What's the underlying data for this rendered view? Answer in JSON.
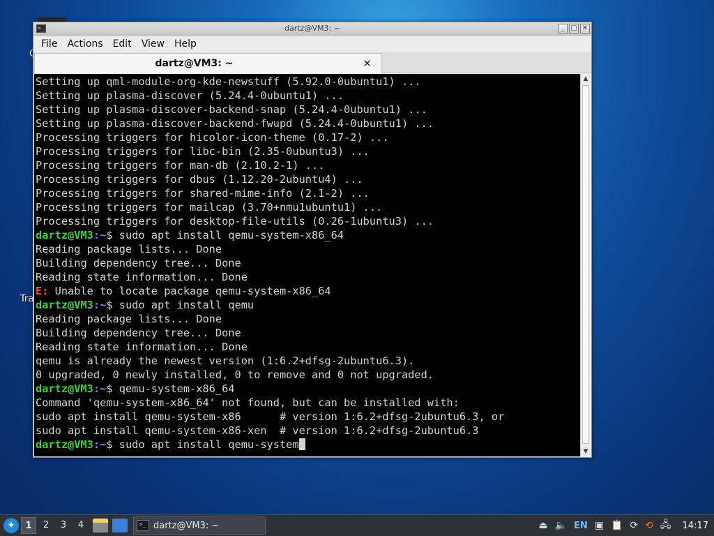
{
  "desktop": {
    "label_c": "C",
    "label_tra": "Tra"
  },
  "window": {
    "title": "dartz@VM3: ~",
    "menu": [
      "File",
      "Actions",
      "Edit",
      "View",
      "Help"
    ],
    "tab_label": "dartz@VM3: ~",
    "tab_close": "✕",
    "buttons": {
      "minimize": "_",
      "maximize": "□",
      "close": "✕"
    }
  },
  "terminal": {
    "prompt_user": "dartz@VM3",
    "prompt_path": ":~",
    "prompt_symbol": "$ ",
    "lines": [
      {
        "t": "out",
        "text": "Setting up qml-module-org-kde-newstuff (5.92.0-0ubuntu1) ..."
      },
      {
        "t": "out",
        "text": "Setting up plasma-discover (5.24.4-0ubuntu1) ..."
      },
      {
        "t": "out",
        "text": "Setting up plasma-discover-backend-snap (5.24.4-0ubuntu1) ..."
      },
      {
        "t": "out",
        "text": "Setting up plasma-discover-backend-fwupd (5.24.4-0ubuntu1) ..."
      },
      {
        "t": "out",
        "text": "Processing triggers for hicolor-icon-theme (0.17-2) ..."
      },
      {
        "t": "out",
        "text": "Processing triggers for libc-bin (2.35-0ubuntu3) ..."
      },
      {
        "t": "out",
        "text": "Processing triggers for man-db (2.10.2-1) ..."
      },
      {
        "t": "out",
        "text": "Processing triggers for dbus (1.12.20-2ubuntu4) ..."
      },
      {
        "t": "out",
        "text": "Processing triggers for shared-mime-info (2.1-2) ..."
      },
      {
        "t": "out",
        "text": "Processing triggers for mailcap (3.70+nmu1ubuntu1) ..."
      },
      {
        "t": "out",
        "text": "Processing triggers for desktop-file-utils (0.26-1ubuntu3) ..."
      },
      {
        "t": "cmd",
        "text": "sudo apt install qemu-system-x86_64"
      },
      {
        "t": "out",
        "text": "Reading package lists... Done"
      },
      {
        "t": "out",
        "text": "Building dependency tree... Done"
      },
      {
        "t": "out",
        "text": "Reading state information... Done"
      },
      {
        "t": "err",
        "prefix": "E:",
        "text": " Unable to locate package qemu-system-x86_64"
      },
      {
        "t": "cmd",
        "text": "sudo apt install qemu"
      },
      {
        "t": "out",
        "text": "Reading package lists... Done"
      },
      {
        "t": "out",
        "text": "Building dependency tree... Done"
      },
      {
        "t": "out",
        "text": "Reading state information... Done"
      },
      {
        "t": "out",
        "text": "qemu is already the newest version (1:6.2+dfsg-2ubuntu6.3)."
      },
      {
        "t": "out",
        "text": "0 upgraded, 0 newly installed, 0 to remove and 0 not upgraded."
      },
      {
        "t": "cmd",
        "text": "qemu-system-x86_64"
      },
      {
        "t": "out",
        "text": "Command 'qemu-system-x86_64' not found, but can be installed with:"
      },
      {
        "t": "out",
        "text": "sudo apt install qemu-system-x86      # version 1:6.2+dfsg-2ubuntu6.3, or"
      },
      {
        "t": "out",
        "text": "sudo apt install qemu-system-x86-xen  # version 1:6.2+dfsg-2ubuntu6.3"
      },
      {
        "t": "input",
        "text": "sudo apt install qemu-system"
      }
    ]
  },
  "taskbar": {
    "workspaces": [
      "1",
      "2",
      "3",
      "4"
    ],
    "active_workspace": "1",
    "task_label": "dartz@VM3: ~",
    "lang": "EN",
    "clock": "14:17"
  },
  "colors": {
    "prompt_user": "#3ad13a",
    "prompt_path": "#5b8fe6",
    "error": "#ff4a4a",
    "terminal_bg": "#000000",
    "terminal_fg": "#d3d3d3"
  }
}
